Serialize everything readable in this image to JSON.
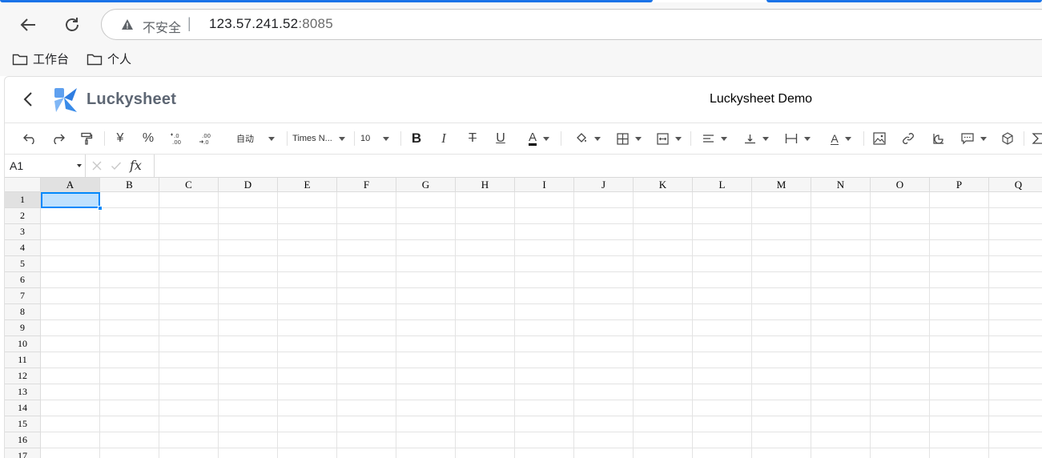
{
  "browser": {
    "security_label": "不安全",
    "separator": "|",
    "url_host": "123.57.241.52",
    "url_port": ":8085",
    "bookmarks": [
      {
        "label": "工作台"
      },
      {
        "label": "个人"
      }
    ],
    "accent": "#1a73e8"
  },
  "app": {
    "brand": "Luckysheet",
    "title": "Luckysheet Demo",
    "brand_color": "#4a8bdb"
  },
  "toolbar": {
    "currency": "¥",
    "percent": "%",
    "format": "自动",
    "font": "Times N...",
    "font_size": "10",
    "bold": "B",
    "italic": "I",
    "strike": "T",
    "underline": "U",
    "text_color": "A",
    "text_rotate": "A"
  },
  "formula_bar": {
    "cell_ref": "A1",
    "fx": "fx"
  },
  "grid": {
    "columns": [
      "A",
      "B",
      "C",
      "D",
      "E",
      "F",
      "G",
      "H",
      "I",
      "J",
      "K",
      "L",
      "M",
      "N",
      "O",
      "P",
      "Q"
    ],
    "rows": [
      "1",
      "2",
      "3",
      "4",
      "5",
      "6",
      "7",
      "8",
      "9",
      "10",
      "11",
      "12",
      "13",
      "14",
      "15",
      "16",
      "17"
    ],
    "selected_cell": "A1",
    "selection_color": "#0188fb"
  }
}
